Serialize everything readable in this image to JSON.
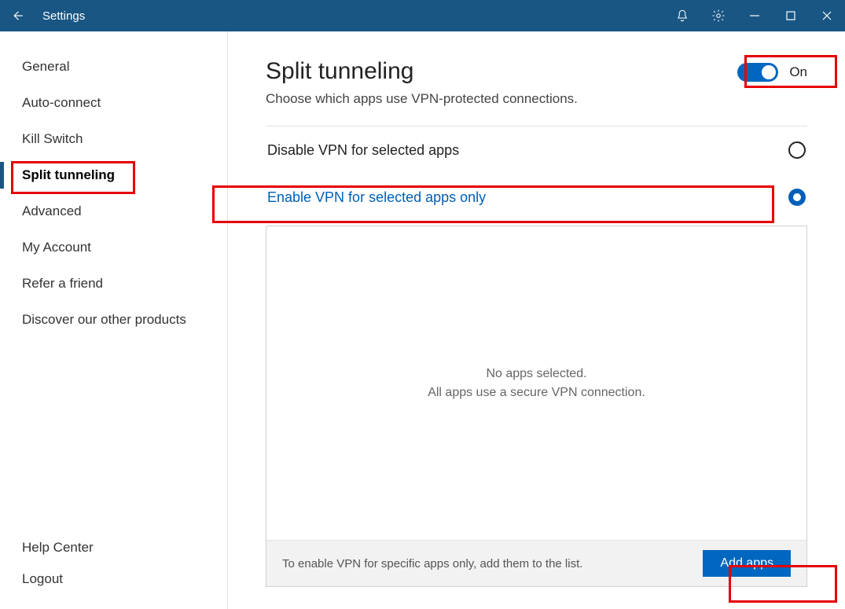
{
  "titlebar": {
    "title": "Settings"
  },
  "sidebar": {
    "items": [
      {
        "label": "General",
        "selected": false
      },
      {
        "label": "Auto-connect",
        "selected": false
      },
      {
        "label": "Kill Switch",
        "selected": false
      },
      {
        "label": "Split tunneling",
        "selected": true
      },
      {
        "label": "Advanced",
        "selected": false
      },
      {
        "label": "My Account",
        "selected": false
      },
      {
        "label": "Refer a friend",
        "selected": false
      },
      {
        "label": "Discover our other products",
        "selected": false
      }
    ],
    "bottom": [
      {
        "label": "Help Center"
      },
      {
        "label": "Logout"
      }
    ]
  },
  "page": {
    "title": "Split tunneling",
    "subtitle": "Choose which apps use VPN-protected connections.",
    "toggle_state": "On"
  },
  "options": [
    {
      "label": "Disable VPN for selected apps",
      "selected": false
    },
    {
      "label": "Enable VPN for selected apps only",
      "selected": true
    }
  ],
  "apps": {
    "empty_line1": "No apps selected.",
    "empty_line2": "All apps use a secure VPN connection.",
    "footer_hint": "To enable VPN for specific apps only, add them to the list.",
    "add_button": "Add apps"
  }
}
